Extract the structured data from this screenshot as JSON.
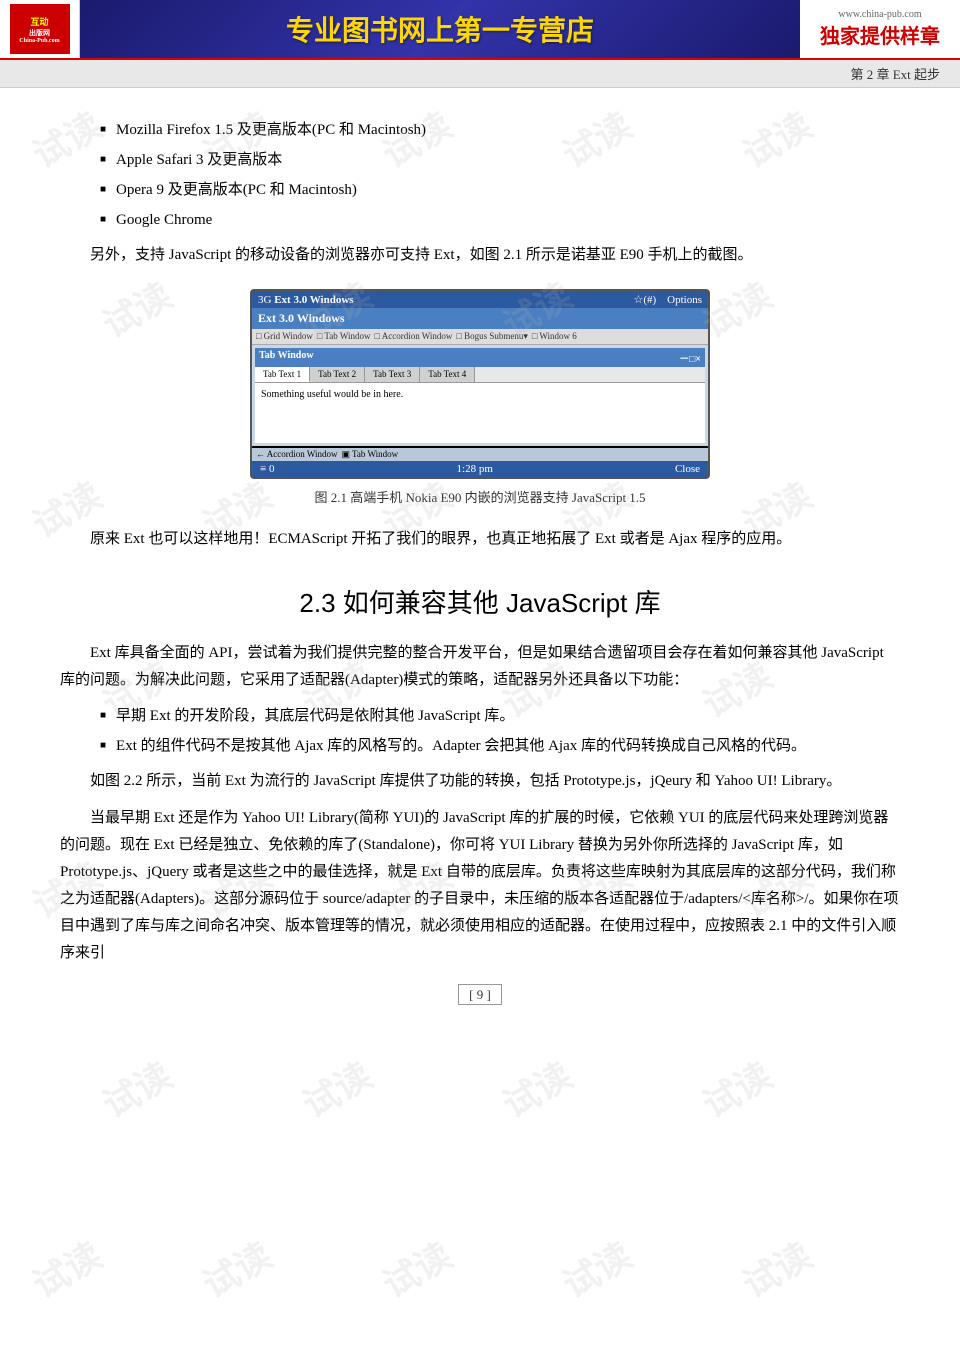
{
  "header": {
    "logo_text_top": "互动出版网",
    "logo_text_bottom": "China-Pub.com",
    "center_text": "专业图书网上第一专营店",
    "right_url": "www.china-pub.com",
    "right_slogan": "独家提供样章"
  },
  "page_header": {
    "text": "第 2 章   Ext 起步"
  },
  "watermarks": [
    "试读",
    "试读",
    "试读",
    "试读",
    "试读",
    "试读",
    "试读",
    "试读",
    "试读",
    "试读",
    "试读",
    "试读"
  ],
  "bullet_items": [
    "Mozilla Firefox 1.5 及更高版本(PC 和 Macintosh)",
    "Apple Safari 3 及更高版本",
    "Opera 9 及更高版本(PC 和 Macintosh)",
    "Google Chrome"
  ],
  "para1": "另外，支持 JavaScript 的移动设备的浏览器亦可支持 Ext，如图 2.1 所示是诺基亚 E90 手机上的截图。",
  "nokia_screen": {
    "statusbar_left": "3G  Ext 3.0 Windows",
    "statusbar_right": "☆☆(#)    Options",
    "titlebar": "Ext 3.0 Windows",
    "toolbar_items": [
      "□ Grid Window",
      "□ Tab Window",
      "□ Accordion Window",
      "□ Bogus Submenu▼",
      "□ Window 6"
    ],
    "win_title": "Tab Window",
    "win_close": "－□×",
    "tabs": [
      "Tab Text 1",
      "Tab Text 2",
      "Tab Text 3",
      "Tab Text 4"
    ],
    "active_tab": 0,
    "content_text": "Something useful would be in here.",
    "accordion_items": [
      "← Accordion Window",
      "▣ Tab Window"
    ],
    "bottom_left": "≡ 0",
    "bottom_time": "1:28 pm",
    "bottom_right": "Close"
  },
  "figure_caption": "图 2.1    高端手机 Nokia E90 内嵌的浏览器支持 JavaScript 1.5",
  "para2": "原来 Ext 也可以这样地用！ECMAScript 开拓了我们的眼界，也真正地拓展了 Ext 或者是 Ajax 程序的应用。",
  "section_title": "2.3    如何兼容其他 JavaScript 库",
  "para3": "Ext 库具备全面的 API，尝试着为我们提供完整的整合开发平台，但是如果结合遗留项目会存在着如何兼容其他 JavaScript 库的问题。为解决此问题，它采用了适配器(Adapter)模式的策略，适配器另外还具备以下功能：",
  "bullet2_items": [
    "早期 Ext 的开发阶段，其底层代码是依附其他 JavaScript 库。",
    "Ext 的组件代码不是按其他 Ajax 库的风格写的。Adapter 会把其他 Ajax 库的代码转换成自己风格的代码。"
  ],
  "para4": "如图 2.2 所示，当前 Ext 为流行的 JavaScript 库提供了功能的转换，包括 Prototype.js，jQeury 和 Yahoo UI! Library。",
  "para5": "当最早期 Ext 还是作为 Yahoo UI! Library(简称 YUI)的 JavaScript 库的扩展的时候，它依赖 YUI 的底层代码来处理跨浏览器的问题。现在 Ext 已经是独立、免依赖的库了(Standalone)，你可将 YUI Library 替换为另外你所选择的 JavaScript 库，如 Prototype.js、jQuery 或者是这些之中的最佳选择，就是 Ext 自带的底层库。负责将这些库映射为其底层库的这部分代码，我们称之为适配器(Adapters)。这部分源码位于 source/adapter 的子目录中，未压缩的版本各适配器位于/adapters/<库名称>/。如果你在项目中遇到了库与库之间命名冲突、版本管理等的情况，就必须使用相应的适配器。在使用过程中，应按照表 2.1 中的文件引入顺序来引",
  "page_number": "[ 9 ]"
}
